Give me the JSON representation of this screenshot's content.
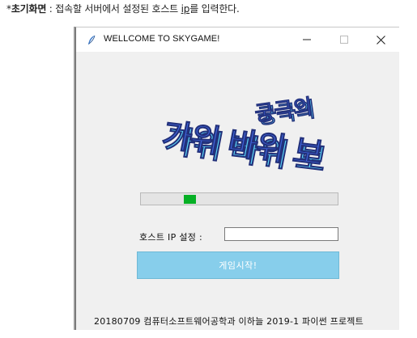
{
  "doc_caption": {
    "bullet": "*",
    "strong": "초기화면",
    "text_before": " : 접속할 서버에서 설정된 호스트 ",
    "underlined": "ip",
    "text_after": "를 입력한다."
  },
  "window": {
    "title": "WELLCOME TO SKYGAME!",
    "icon": "feather-icon",
    "controls": {
      "minimize": "minimize-icon",
      "maximize": "maximize-icon",
      "close": "close-icon"
    }
  },
  "logo": {
    "line1": "궁극의",
    "line2": "가위 바위 보",
    "colors": {
      "face": "#3f63d8",
      "side": "#5ad0f2",
      "dark": "#22307a"
    }
  },
  "progress": {
    "value_fraction": 0.06,
    "color": "#06b025"
  },
  "host": {
    "label": "호스트 IP 설정 :",
    "value": "",
    "placeholder": ""
  },
  "start_button": {
    "label": "게임시작!",
    "color": "#87ceeb"
  },
  "footer": {
    "text": "20180709 컴퓨터소프트웨어공학과 이하늘 2019-1 파이썬 프로젝트"
  }
}
